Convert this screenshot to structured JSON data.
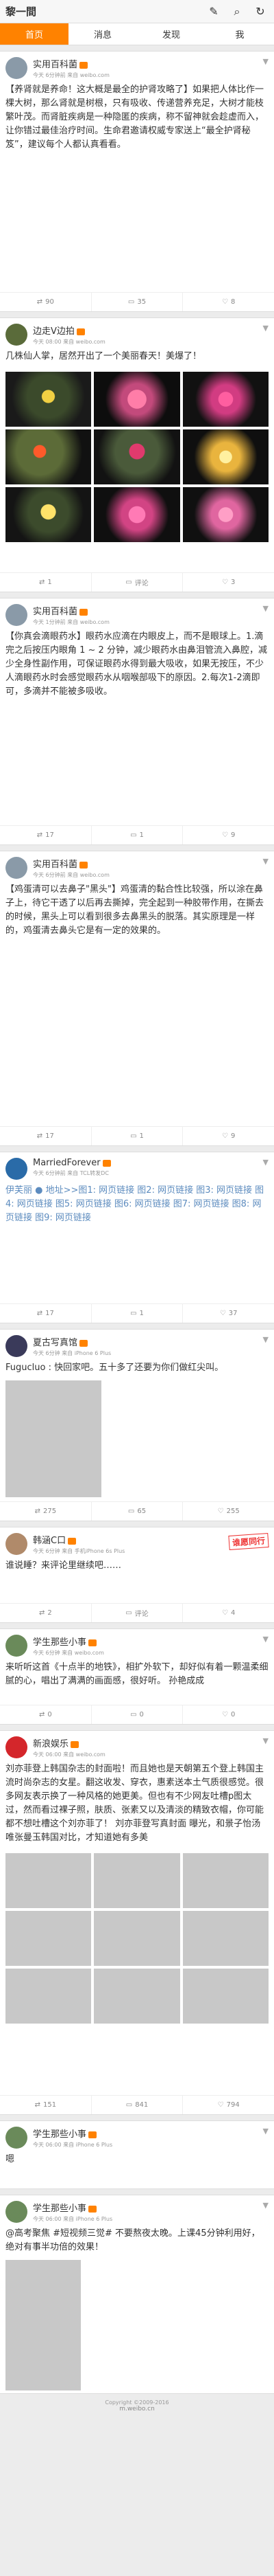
{
  "app": {
    "title": "黎一間"
  },
  "tabs": [
    "首页",
    "消息",
    "发现",
    "我"
  ],
  "posts": [
    {
      "user": "实用百科菌",
      "time": "今天 6分钟前 来自 weibo.com",
      "text": "【养肾就是养命！这大概是最全的护肾攻略了】如果把人体比作一棵大树，那么肾就是树根，只有吸收、传递营养充足，大树才能枝繁叶茂。而肾脏疾病是一种隐匿的疾病，称不留神就会趁虚而入，让你错过最佳治疗时间。生命君邀请权威专家送上“最全护肾秘笈”，建议每个人都认真看看。",
      "reposts": "90",
      "comments": "35",
      "likes": "8"
    },
    {
      "user": "边走V边拍",
      "time": "今天 08:00 来自 weibo.com",
      "text": "几株仙人掌，居然开出了一个美丽春天！美爆了！",
      "reposts": "1",
      "comments": "评论",
      "likes": "3"
    },
    {
      "user": "实用百科菌",
      "time": "今天 1分钟前 来自 weibo.com",
      "text": "【你真会滴眼药水】眼药水应滴在内眼皮上，而不是眼球上。1.滴完之后按压内眼角 1 ~ 2 分钟，减少眼药水由鼻泪管流入鼻腔，减少全身性副作用，可保证眼药水得到最大吸收，如果无按压，不少人滴眼药水时会感觉眼药水从咽喉部吸下的原因。2.每次1-2滴即可，多滴并不能被多吸收。",
      "reposts": "17",
      "comments": "1",
      "likes": "9"
    },
    {
      "user": "实用百科菌",
      "time": "今天 6分钟前 来自 weibo.com",
      "text": "【鸡蛋清可以去鼻子\"黑头\"】鸡蛋清的黏合性比较强，所以涂在鼻子上，待它干透了以后再去撕掉，完全起到一种胶带作用，在撕去的时候，黑头上可以看到很多去鼻黑头的脱落。其实原理是一样的，鸡蛋清去鼻头它是有一定的效果的。",
      "reposts": "17",
      "comments": "1",
      "likes": "9"
    },
    {
      "user": "MarriedForever",
      "time": "今天 6分钟前 来自 TCL转发DC",
      "text": "伊芙丽 ● 地址>>图1: 网页链接 图2: 网页链接 图3: 网页链接 图4: 网页链接 图5: 网页链接 图6: 网页链接 图7: 网页链接 图8: 网页链接 图9: 网页链接",
      "reposts": "17",
      "comments": "1",
      "likes": "37"
    },
    {
      "user": "夏古写真馆",
      "time": "今天 6分钟 来自 iPhone 6 Plus",
      "text": "Fugucluo : 快回家吧。五十多了还要为你们做红尖叫。",
      "reposts": "275",
      "comments": "65",
      "likes": "255"
    },
    {
      "user": "韩涵C口",
      "time": "今天 6分钟 来自 手机iPhone 6s Plus",
      "text": "谁说睡？来评论里继续吧……",
      "badge": "谁愿同行",
      "reposts": "2",
      "comments": "评论",
      "likes": "4"
    },
    {
      "user": "学生那些小事",
      "time": "今天 6分钟 来自 weibo.com",
      "text": "来听听这首《十点半的地铁》，相扩外软下，却好似有着一颗温柔细腻的心，唱出了满满的画面感，很好听。 孙艳成成",
      "reposts": "0",
      "comments": "0",
      "likes": "0"
    },
    {
      "user": "新浪娱乐",
      "time": "今天 06:00 来自 weibo.com",
      "text": "刘亦菲登上韩国杂志的封面啦！而且她也是天朝第五个登上韩国主流时尚杂志的女星。翻这收发、穿衣，惠素送本土气质很感觉。很多网友表示换了一种风格的她更美。但也有不少网友吐槽p图太过，然而看过裸子照，肤质、张素又以及清淡的精致衣帽，你可能都不想吐槽这个刘亦菲了！ 刘亦菲登写真封面 曝光，和景子怡汤唯张曼玉韩国对比，才知道她有多美",
      "reposts": "151",
      "comments": "841",
      "likes": "794"
    },
    {
      "user": "学生那些小事",
      "time": "今天 06:00 来自 iPhone 6 Plus",
      "text": "嗯",
      "reposts": "",
      "comments": "",
      "likes": ""
    },
    {
      "user": "学生那些小事",
      "time": "今天 06:00 来自 iPhone 6 Plus",
      "text": "@高考聚焦 #短视频三觉# 不要熬夜太晚。上课45分钟利用好，绝对有事半功倍的效果！",
      "reposts": "",
      "comments": "",
      "likes": ""
    }
  ],
  "footer": {
    "line1": "Copyright ©2009-2016",
    "line2": "m.weibo.cn"
  },
  "colors": {
    "accent": "#ff8200",
    "link": "#eb7350"
  }
}
